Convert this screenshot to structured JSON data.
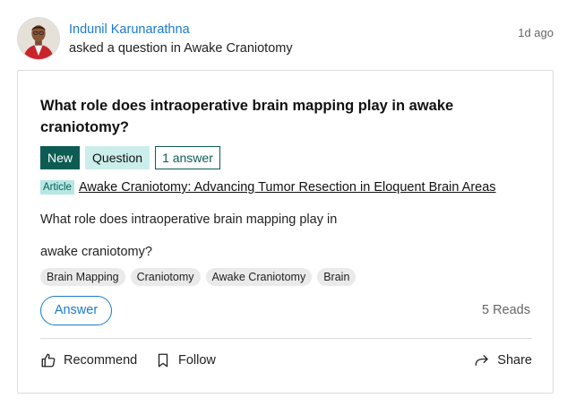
{
  "header": {
    "author_name": "Indunil Karunarathna",
    "activity": "asked a question in Awake Craniotomy",
    "timestamp": "1d ago"
  },
  "question": {
    "title": "What role does intraoperative brain mapping play in awake craniotomy?",
    "chips": {
      "new": "New",
      "type": "Question",
      "answers": "1 answer"
    },
    "article": {
      "badge": "Article",
      "title": "Awake Craniotomy: Advancing Tumor Resection in Eloquent Brain Areas"
    },
    "body_lines": [
      "What role does intraoperative brain mapping play in",
      "awake craniotomy?"
    ],
    "tags": [
      "Brain Mapping",
      "Craniotomy",
      "Awake Craniotomy",
      "Brain"
    ],
    "answer_button": "Answer",
    "reads": "5 Reads"
  },
  "actions": {
    "recommend": {
      "label": "Recommend",
      "icon": "thumbs-up-icon"
    },
    "follow": {
      "label": "Follow",
      "icon": "bookmark-icon"
    },
    "share": {
      "label": "Share",
      "icon": "share-arrow-icon"
    }
  },
  "colors": {
    "link_blue": "#1a7ad0",
    "chip_teal": "#0d5c54",
    "chip_light_teal": "#cbeeec",
    "article_badge": "#b5e7e3"
  }
}
